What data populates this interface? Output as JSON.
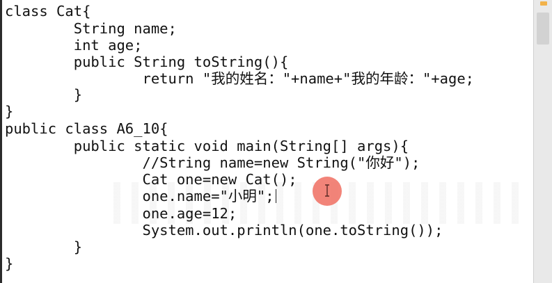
{
  "editor": {
    "lines": [
      "class Cat{",
      "        String name;",
      "        int age;",
      "        public String toString(){",
      "                return \"我的姓名：\"+name+\"我的年龄：\"+age;",
      "        }",
      "}",
      "public class A6_10{",
      "        public static void main(String[] args){",
      "                //String name=new String(\"你好\");",
      "                Cat one=new Cat();",
      "                one.name=\"小明\";",
      "                one.age=12;",
      "                System.out.println(one.toString());",
      "        }",
      "}"
    ],
    "caret_line_index": 11
  },
  "colors": {
    "background": "#ffffff",
    "text": "#111111",
    "cursor_highlight": "#ef695c",
    "scroll_marker": "#f2b24a",
    "scrollbar_track": "#e9e9e9"
  },
  "icons": {
    "mouse_cursor": "ibeam-cursor-icon",
    "cursor_highlight": "click-highlight-circle"
  }
}
